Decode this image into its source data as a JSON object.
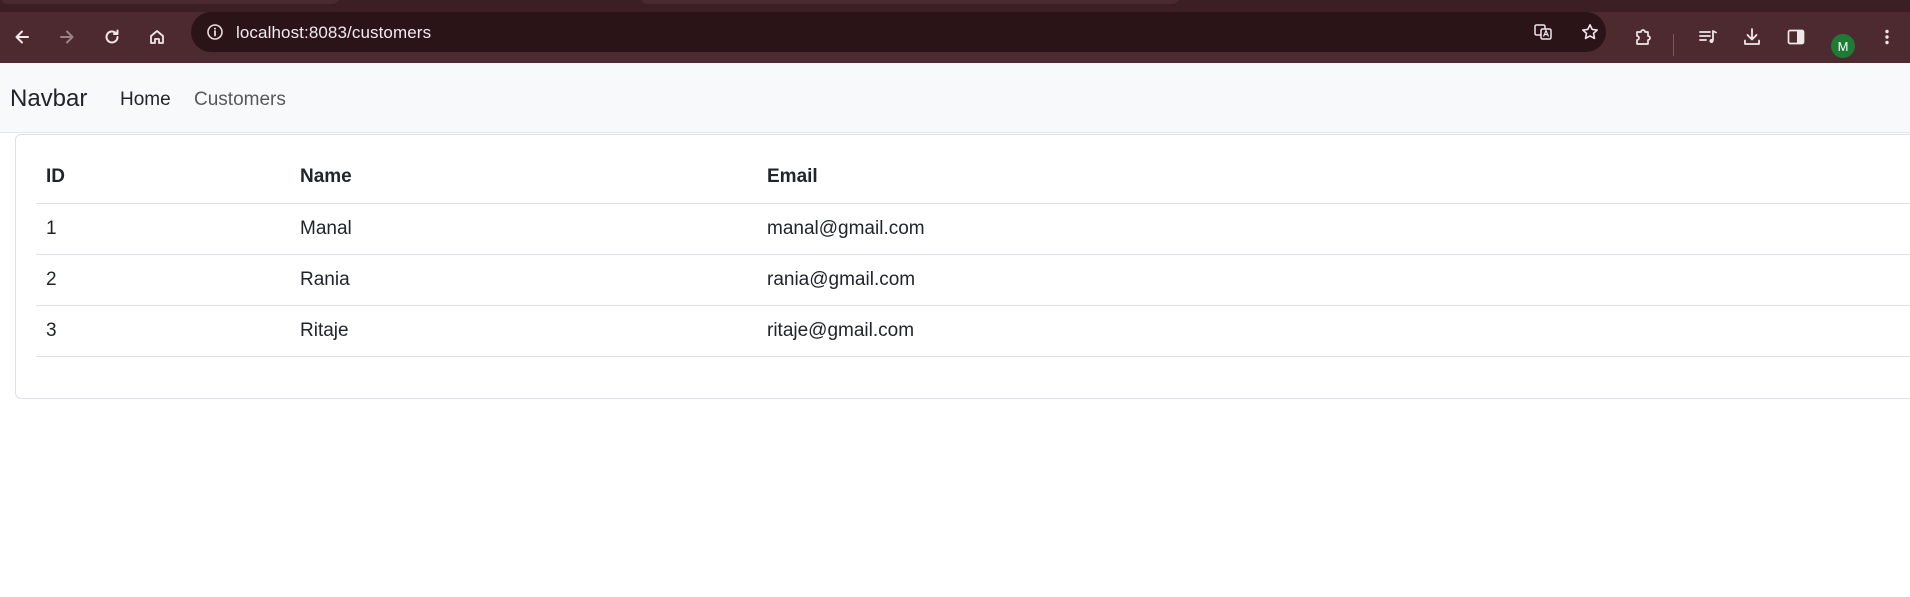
{
  "browser": {
    "url": "localhost:8083/customers",
    "avatar_initial": "M",
    "icons": {
      "back": "arrow-left-icon",
      "forward": "arrow-right-icon",
      "reload": "reload-icon",
      "home": "home-icon",
      "site_info": "info-icon",
      "translate": "translate-icon",
      "bookmark": "star-icon",
      "extensions": "puzzle-icon",
      "media": "media-queue-icon",
      "downloads": "download-icon",
      "side_panel": "side-panel-icon",
      "menu": "kebab-menu-icon"
    }
  },
  "navbar": {
    "brand": "Navbar",
    "links": [
      {
        "label": "Home",
        "active": true
      },
      {
        "label": "Customers",
        "active": false
      }
    ]
  },
  "table": {
    "headers": [
      "ID",
      "Name",
      "Email"
    ],
    "rows": [
      [
        "1",
        "Manal",
        "manal@gmail.com"
      ],
      [
        "2",
        "Rania",
        "rania@gmail.com"
      ],
      [
        "3",
        "Ritaje",
        "ritaje@gmail.com"
      ]
    ]
  },
  "colors": {
    "chrome_toolbar": "#4c2a30",
    "omnibox": "#2a1418",
    "navbar_bg": "#f8f9fa",
    "avatar": "#1e7b34"
  }
}
